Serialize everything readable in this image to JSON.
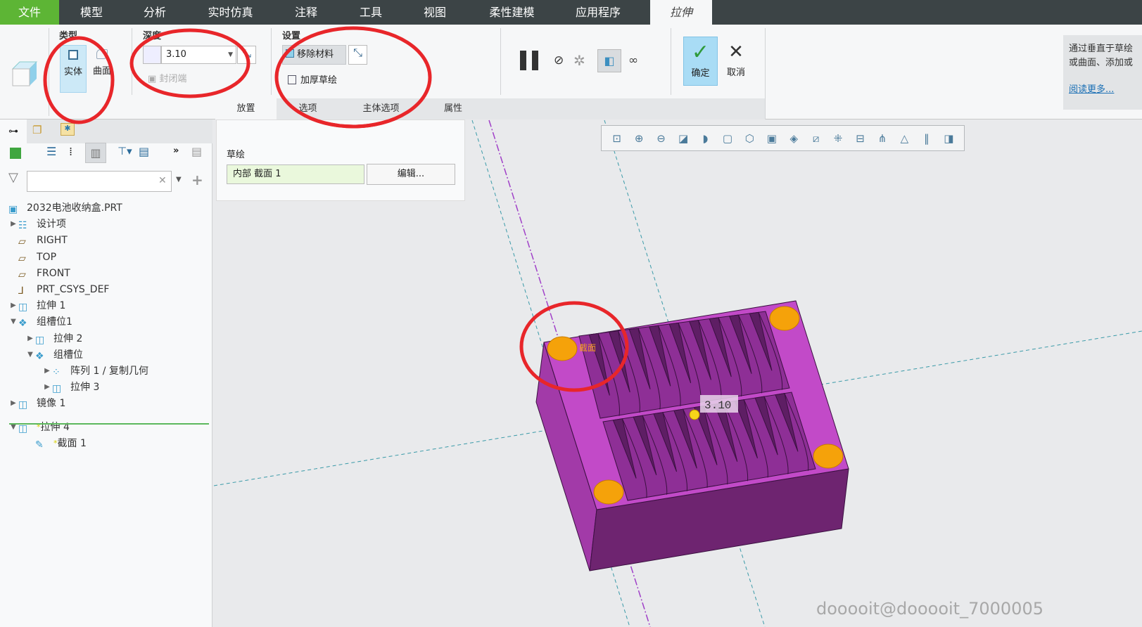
{
  "menubar": {
    "tabs": [
      "文件",
      "模型",
      "分析",
      "实时仿真",
      "注释",
      "工具",
      "视图",
      "柔性建模",
      "应用程序",
      "拉伸"
    ],
    "active": "拉伸"
  },
  "ribbon": {
    "type_group": {
      "label": "类型",
      "solid": "实体",
      "surface": "曲面"
    },
    "depth_group": {
      "label": "深度",
      "value": "3.10",
      "capped_ends": "封闭端"
    },
    "settings_group": {
      "label": "设置",
      "remove_material": "移除材料",
      "thicken_sketch": "加厚草绘"
    },
    "confirm": "确定",
    "cancel": "取消",
    "subtabs": [
      "放置",
      "选项",
      "主体选项",
      "属性"
    ],
    "help": {
      "line1": "通过垂直于草绘",
      "line2": "或曲面、添加或",
      "link": "阅读更多..."
    }
  },
  "placement_panel": {
    "label": "草绘",
    "sketch_value": "内部 截面 1",
    "edit_button": "编辑..."
  },
  "tree": {
    "filter_placeholder": "",
    "items": [
      {
        "label": "2032电池收纳盒.PRT",
        "level": 0,
        "toggle": ""
      },
      {
        "label": "设计项",
        "level": 1,
        "toggle": "▶"
      },
      {
        "label": "RIGHT",
        "level": 1,
        "toggle": ""
      },
      {
        "label": "TOP",
        "level": 1,
        "toggle": ""
      },
      {
        "label": "FRONT",
        "level": 1,
        "toggle": ""
      },
      {
        "label": "PRT_CSYS_DEF",
        "level": 1,
        "toggle": ""
      },
      {
        "label": "拉伸 1",
        "level": 1,
        "toggle": "▶"
      },
      {
        "label": "组槽位1",
        "level": 1,
        "toggle": "▼"
      },
      {
        "label": "拉伸 2",
        "level": 2,
        "toggle": "▶"
      },
      {
        "label": "组槽位",
        "level": 2,
        "toggle": "▼"
      },
      {
        "label": "阵列 1 / 复制几何",
        "level": 3,
        "toggle": "▶"
      },
      {
        "label": "拉伸 3",
        "level": 3,
        "toggle": "▶"
      },
      {
        "label": "镜像 1",
        "level": 1,
        "toggle": "▶"
      },
      {
        "label": "拉伸 4",
        "level": 1,
        "toggle": "▼"
      },
      {
        "label": "截面 1",
        "level": 2,
        "toggle": ""
      }
    ]
  },
  "viewport": {
    "dimension": "3.10",
    "section_label": "截面",
    "watermark": "dooooit@dooooit_7000005"
  },
  "colors": {
    "menubar": "#3c4446",
    "file_tab": "#5db535",
    "part": "#b83fc0",
    "part_dark": "#6e2470",
    "hole": "#f5a20a",
    "annotation": "#e8262a",
    "confirm_bg": "#a9dcf5"
  }
}
